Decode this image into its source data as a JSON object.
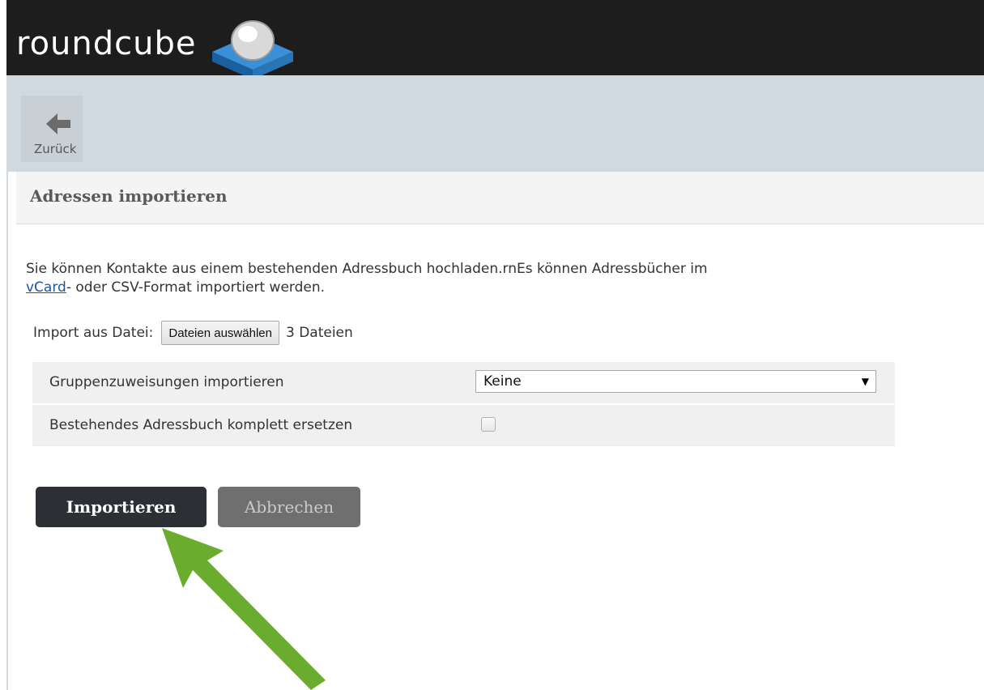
{
  "header": {
    "logo_text": "roundcube"
  },
  "toolbar": {
    "back_label": "Zurück"
  },
  "panel": {
    "title": "Adressen importieren",
    "intro_text": "Sie können Kontakte aus einem bestehenden Adressbuch hochladen.rnEs können Adressbücher im",
    "intro_link": "vCard",
    "intro_tail": "- oder CSV-Format importiert werden.",
    "file_label": "Import aus Datei:",
    "file_button": "Dateien auswählen",
    "file_status": "3 Dateien",
    "options": [
      {
        "label": "Gruppenzuweisungen importieren",
        "value": "Keine"
      },
      {
        "label": "Bestehendes Adressbuch komplett ersetzen",
        "checked": false
      }
    ],
    "import_button": "Importieren",
    "cancel_button": "Abbrechen"
  },
  "colors": {
    "header_bg": "#1d1d1d",
    "toolbar_bg": "#d0d9e0",
    "primary_button": "#2c2f33",
    "secondary_button": "#6f6f6f",
    "annotation_arrow": "#6aad2e"
  },
  "icons": {
    "logo": "roundcube-cube-icon",
    "back": "arrow-left-icon",
    "annotation": "green-arrow-icon"
  }
}
